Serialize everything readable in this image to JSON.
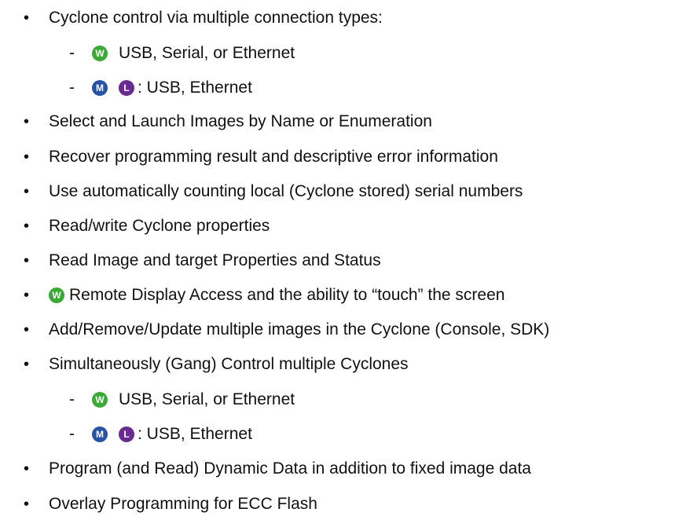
{
  "badges": {
    "w": {
      "letter": "W",
      "color": "#3aa935",
      "icon": "w-badge-icon"
    },
    "m": {
      "letter": "M",
      "color": "#2653a5",
      "icon": "m-badge-icon"
    },
    "l": {
      "letter": "L",
      "color": "#6a2b91",
      "icon": "l-badge-icon"
    }
  },
  "bullet_char": "•",
  "dash_char": "-",
  "items": [
    {
      "text": "Cyclone control via multiple connection types:"
    },
    {
      "sub_w": "USB, Serial, or Ethernet",
      "sub_ml": ": USB, Ethernet"
    },
    {
      "text": "Select and Launch Images by Name or Enumeration"
    },
    {
      "text": "Recover programming result and descriptive error information"
    },
    {
      "text": "Use automatically counting local (Cyclone stored) serial numbers"
    },
    {
      "text": "Read/write Cyclone properties"
    },
    {
      "text": "Read Image and target Properties and Status"
    },
    {
      "text": "Remote Display Access and the ability to “touch” the screen"
    },
    {
      "text": "Add/Remove/Update multiple images in the Cyclone (Console, SDK)"
    },
    {
      "text": "Simultaneously (Gang) Control multiple Cyclones"
    },
    {
      "sub_w": "USB, Serial, or Ethernet",
      "sub_ml": ": USB, Ethernet"
    },
    {
      "text": "Program (and Read) Dynamic Data in addition to fixed image data"
    },
    {
      "text": "Overlay Programming for ECC Flash"
    }
  ]
}
